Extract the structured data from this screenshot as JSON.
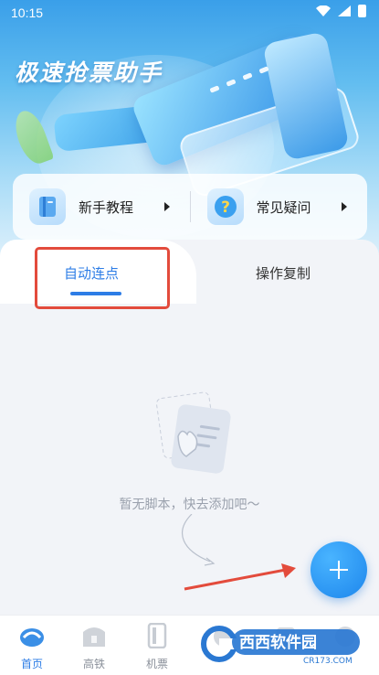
{
  "status_bar": {
    "time": "10:15"
  },
  "app": {
    "title": "极速抢票助手"
  },
  "quick_actions": [
    {
      "label": "新手教程",
      "icon": "book-icon"
    },
    {
      "label": "常见疑问",
      "icon": "question-icon"
    }
  ],
  "tabs": [
    {
      "label": "自动连点",
      "active": true
    },
    {
      "label": "操作复制",
      "active": false
    }
  ],
  "empty_state": {
    "text": "暂无脚本，快去添加吧～"
  },
  "bottom_nav": [
    {
      "label": "首页",
      "icon": "home-icon",
      "active": true
    },
    {
      "label": "高铁",
      "icon": "train-icon",
      "active": false
    },
    {
      "label": "机票",
      "icon": "plane-ticket-icon",
      "active": false
    }
  ],
  "watermark": {
    "text": "西西软件园",
    "sub": "CR173.COM"
  },
  "colors": {
    "accent": "#2d7de6",
    "annotation": "#e34b3c"
  }
}
